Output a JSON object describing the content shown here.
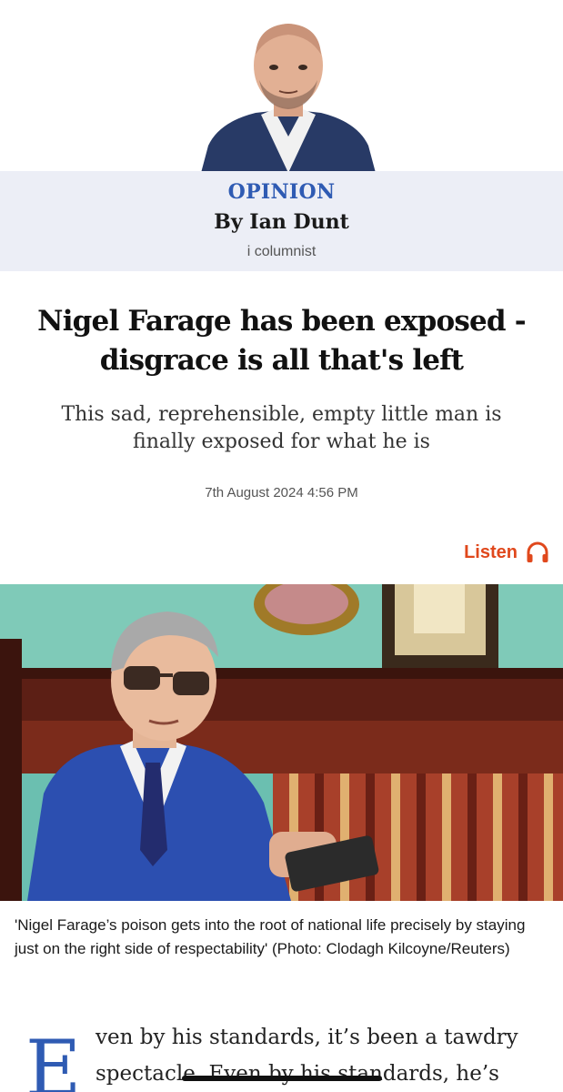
{
  "author": {
    "section_label": "OPINION",
    "byline": "By Ian Dunt",
    "role": "i columnist"
  },
  "article": {
    "headline": "Nigel Farage has been exposed - disgrace is all that's left",
    "standfirst": "This sad, reprehensible, empty little man is finally exposed for what he is",
    "timestamp": "7th August 2024 4:56 PM",
    "listen_label": "Listen",
    "listen_icon": "headphones-icon",
    "caption": "'Nigel Farage’s poison gets into the root of national life precisely by staying just on the right side of respectability' (Photo: Clodagh Kilcoyne/Reuters)",
    "drop_cap": "E",
    "body_lines": [
      "ven by his standards, it’s been a tawdry",
      "spectacle. Even by his standards, he’s"
    ]
  },
  "colors": {
    "accent_blue": "#2f5bb3",
    "listen_orange": "#e0481c",
    "byline_band": "#eceef6"
  }
}
